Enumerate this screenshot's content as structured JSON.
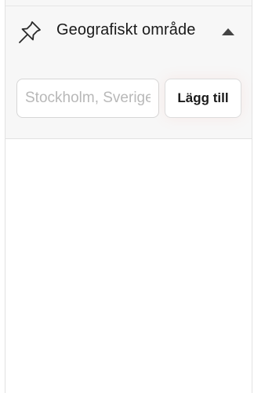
{
  "section": {
    "title": "Geografiskt område",
    "icon": "pushpin-icon",
    "toggle_icon": "caret-up-icon",
    "expanded": true
  },
  "location_input": {
    "value": "",
    "placeholder": "Stockholm, Sverige"
  },
  "add_button": {
    "label": "Lägg till"
  },
  "locations": []
}
